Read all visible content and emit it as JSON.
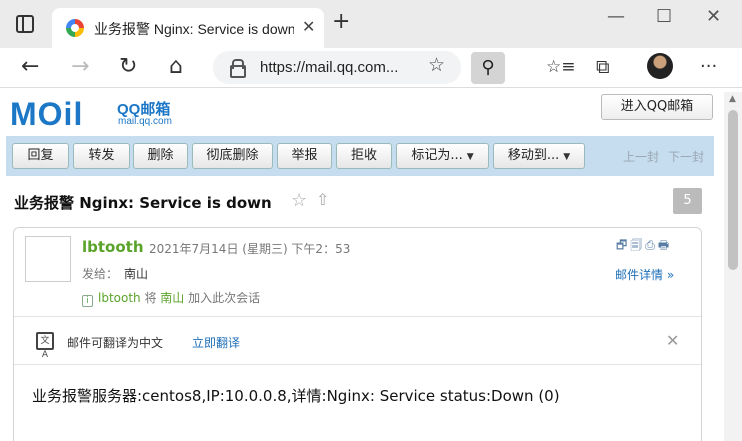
{
  "browser": {
    "tab_title": "业务报警 Nginx: Service is down",
    "tab_close": "✕",
    "new_tab": "+",
    "window_controls": [
      "—",
      "☐",
      "✕"
    ],
    "url": "https://mail.qq.com...",
    "icons": {
      "back": "←",
      "forward": "→",
      "reload": "↻",
      "home": "⌂",
      "favorite": "☆",
      "extension": "⚲",
      "favorites_list": "☆≡",
      "collections": "⧉",
      "menu": "···"
    }
  },
  "page": {
    "logo_big": "MOil",
    "logo_small": "QQ邮箱",
    "logo_domain": "mail.qq.com",
    "enter_button": "进入QQ邮箱",
    "toolbar": {
      "buttons": [
        "回复",
        "转发",
        "删除",
        "彻底删除",
        "举报",
        "拒收",
        "标记为...",
        "移动到..."
      ],
      "prev": "上一封",
      "next": "下一封"
    },
    "subject": "业务报警 Nginx: Service is down",
    "subject_star": "☆",
    "subject_up": "⇧",
    "count": "5",
    "mail": {
      "sender": "lbtooth",
      "date": "2021年7月14日 (星期三) 下午2：53",
      "to_label": "发给：",
      "to_name": "南山",
      "conv_sender": "lbtooth",
      "conv_joiner": " 将 ",
      "conv_target": "南山",
      "conv_suffix": " 加入此次会话",
      "details_link": "邮件详情 »",
      "header_icons": "🗗🗐⎙🖶",
      "translate_icon": "文A",
      "translate_text": "邮件可翻译为中文",
      "translate_link": "立即翻译",
      "translate_close": "✕",
      "body": "业务报警服务器:centos8,IP:10.0.0.8,详情:Nginx: Service status:Down (0)"
    }
  }
}
